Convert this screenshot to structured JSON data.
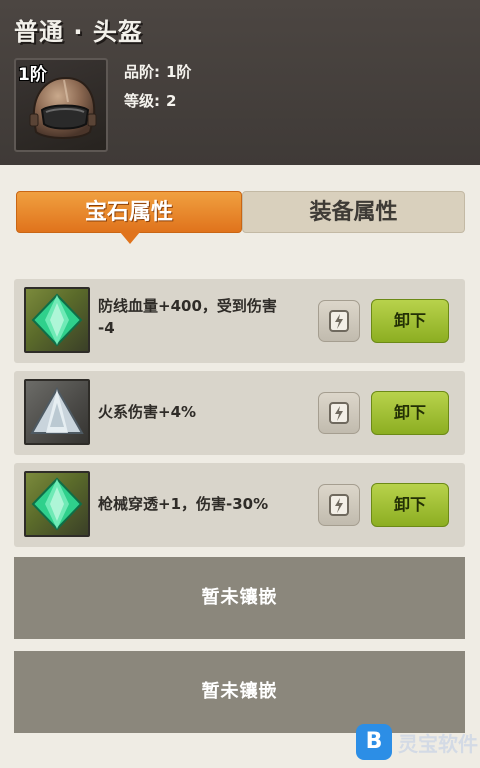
{
  "header": {
    "title": "普通 · 头盔",
    "tier_badge": "1阶",
    "grade_label": "品阶:",
    "grade_value": "1阶",
    "level_label": "等级:",
    "level_value": "2",
    "item_icon": "helmet-icon"
  },
  "tabs": [
    {
      "label": "宝石属性",
      "active": true
    },
    {
      "label": "装备属性",
      "active": false
    }
  ],
  "gems": [
    {
      "icon": "green-gem-icon",
      "text_line1": "防线血量+400，受到伤害",
      "text_line2": "-4",
      "unload_label": "卸下"
    },
    {
      "icon": "triangle-gem-icon",
      "text_line1": "火系伤害+4%",
      "text_line2": "",
      "unload_label": "卸下"
    },
    {
      "icon": "green-gem-icon",
      "text_line1": "枪械穿透+1，伤害-30%",
      "text_line2": "",
      "unload_label": "卸下"
    }
  ],
  "empty_slots": [
    {
      "label": "暂未镶嵌"
    },
    {
      "label": "暂未镶嵌"
    }
  ],
  "watermark": {
    "text": "灵宝软件"
  },
  "colors": {
    "header_bg": "#45403c",
    "tab_active": "#e8821f",
    "tab_inactive": "#d9d0bd",
    "unload_button": "#a2c034",
    "empty_slot_bg": "#8b877c",
    "row_bg": "#d9d5cb"
  }
}
